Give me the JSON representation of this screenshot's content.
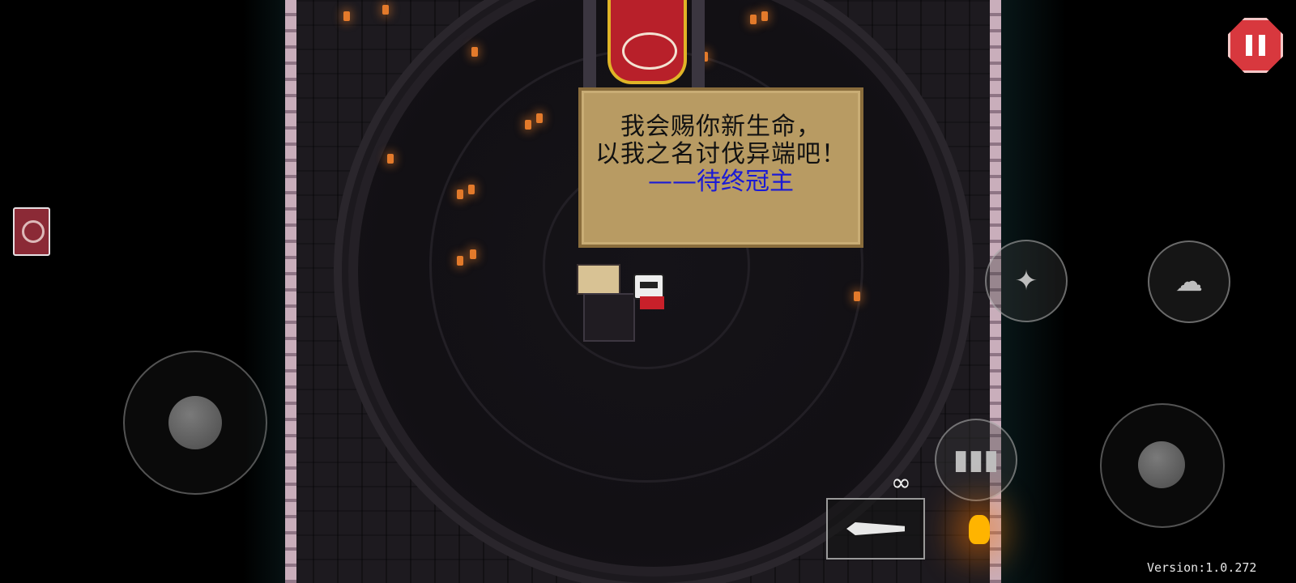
{
  "dialog": {
    "line1": "我会赐你新生命，",
    "line2": "以我之名讨伐异端吧！",
    "signature": "——待终冠主"
  },
  "hud": {
    "ammo": "∞",
    "version": "Version:1.0.272",
    "pause_icon": "pause-icon",
    "book_icon": "book-icon",
    "skill_icon": "skill-icon",
    "ghost_icon": "ghost-icon",
    "chat_icon": "chat-bubble-icon",
    "weapon_icon": "sword-icon"
  },
  "colors": {
    "pause": "#d8383e",
    "dialog_bg": "#b89b63",
    "signature": "#1a1ad6"
  }
}
